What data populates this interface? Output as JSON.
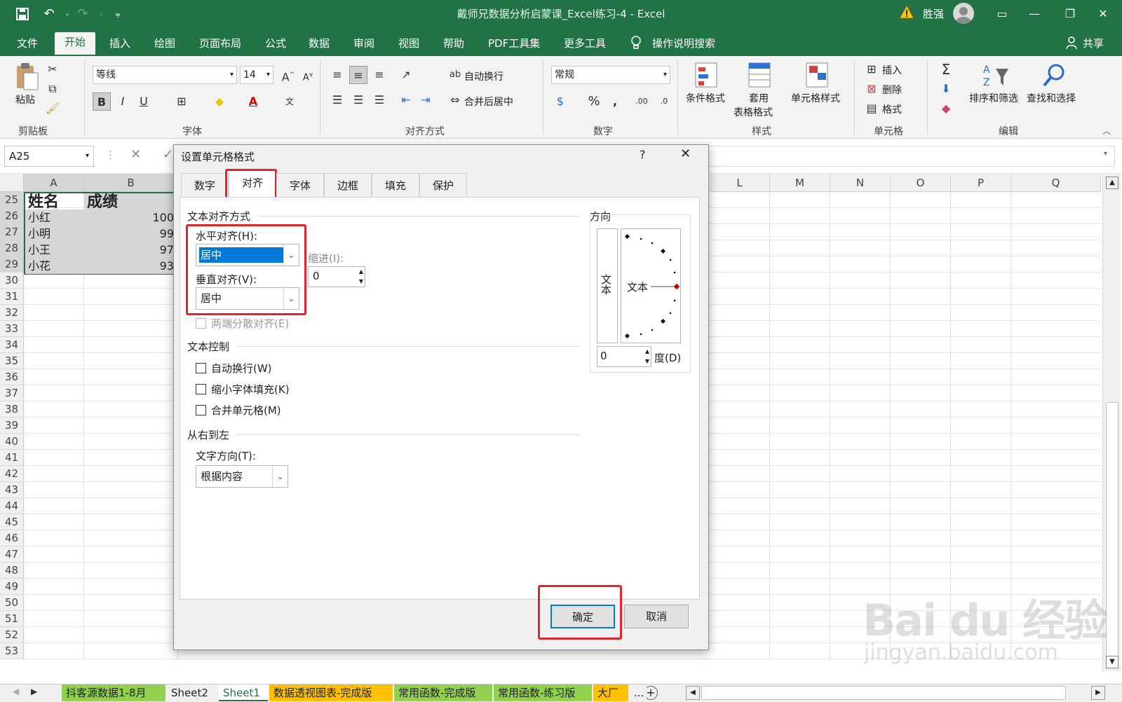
{
  "window": {
    "title": "戴师兄数据分析启蒙课_Excel练习-4  -  Excel",
    "user": "胜强"
  },
  "qat": {
    "save": "save-icon",
    "undo": "undo-icon",
    "redo": "redo-icon"
  },
  "tabs": [
    "文件",
    "开始",
    "插入",
    "绘图",
    "页面布局",
    "公式",
    "数据",
    "审阅",
    "视图",
    "帮助",
    "PDF工具集",
    "更多工具"
  ],
  "tell_me": "操作说明搜索",
  "share": "共享",
  "ribbon": {
    "clipboard": {
      "paste": "粘贴",
      "label": "剪贴板"
    },
    "font": {
      "name": "等线",
      "size": "14",
      "label": "字体",
      "bold": "B",
      "italic": "I",
      "underline": "U"
    },
    "alignment": {
      "wrap": "自动换行",
      "merge": "合并后居中",
      "label": "对齐方式"
    },
    "number": {
      "format": "常规",
      "label": "数字"
    },
    "styles": {
      "cond": "条件格式",
      "table1": "套用",
      "table2": "表格格式",
      "cell_style": "单元格样式",
      "label": "样式"
    },
    "cells": {
      "insert": "插入",
      "delete": "删除",
      "format": "格式",
      "label": "单元格"
    },
    "editing": {
      "sort": "排序和筛选",
      "find": "查找和选择",
      "label": "编辑"
    }
  },
  "formula": {
    "namebox": "A25"
  },
  "columns": [
    "A",
    "B",
    "L",
    "M",
    "N",
    "O",
    "P",
    "Q"
  ],
  "rows": [
    "25",
    "26",
    "27",
    "28",
    "29",
    "30",
    "31",
    "32",
    "33",
    "34",
    "35",
    "36",
    "37",
    "38",
    "39",
    "40",
    "41",
    "42",
    "43",
    "44",
    "45",
    "46",
    "47",
    "48",
    "49",
    "50",
    "51",
    "52",
    "53"
  ],
  "data": {
    "header": [
      "姓名",
      "成绩"
    ],
    "records": [
      [
        "小红",
        "100"
      ],
      [
        "小明",
        "99"
      ],
      [
        "小王",
        "97"
      ],
      [
        "小花",
        "93"
      ]
    ]
  },
  "dialog": {
    "title": "设置单元格格式",
    "help": "?",
    "tabs": [
      "数字",
      "对齐",
      "字体",
      "边框",
      "填充",
      "保护"
    ],
    "text_align": {
      "section": "文本对齐方式",
      "horizontal_label": "水平对齐(H):",
      "horizontal_value": "居中",
      "vertical_label": "垂直对齐(V):",
      "vertical_value": "居中",
      "indent_label": "缩进(I):",
      "indent_value": "0",
      "distributed": "两端分散对齐(E)"
    },
    "text_control": {
      "section": "文本控制",
      "wrap": "自动换行(W)",
      "shrink": "缩小字体填充(K)",
      "merge": "合并单元格(M)"
    },
    "rtl": {
      "section": "从右到左",
      "direction_label": "文字方向(T):",
      "direction_value": "根据内容"
    },
    "orientation": {
      "section": "方向",
      "vertical_text": "文本",
      "text": "文本",
      "degrees": "0",
      "degree_label": "度(D)"
    },
    "ok": "确定",
    "cancel": "取消"
  },
  "sheets": [
    "抖客源数据1-8月",
    "Sheet2",
    "Sheet1",
    "数据透视图表-完成版",
    "常用函数-完成版",
    "常用函数-练习版",
    "大厂",
    "..."
  ],
  "sheet_colors": [
    "#92d050",
    "#f0f0f0",
    "#ffffff",
    "#ffc000",
    "#92d050",
    "#92d050",
    "#ffc000",
    "#f0f0f0"
  ],
  "watermark": {
    "main": "Bai du 经验",
    "sub": "jingyan.baidu.com"
  },
  "colors": {
    "accent": "#217346",
    "highlight": "#e0262a",
    "selection": "#0078d7"
  }
}
